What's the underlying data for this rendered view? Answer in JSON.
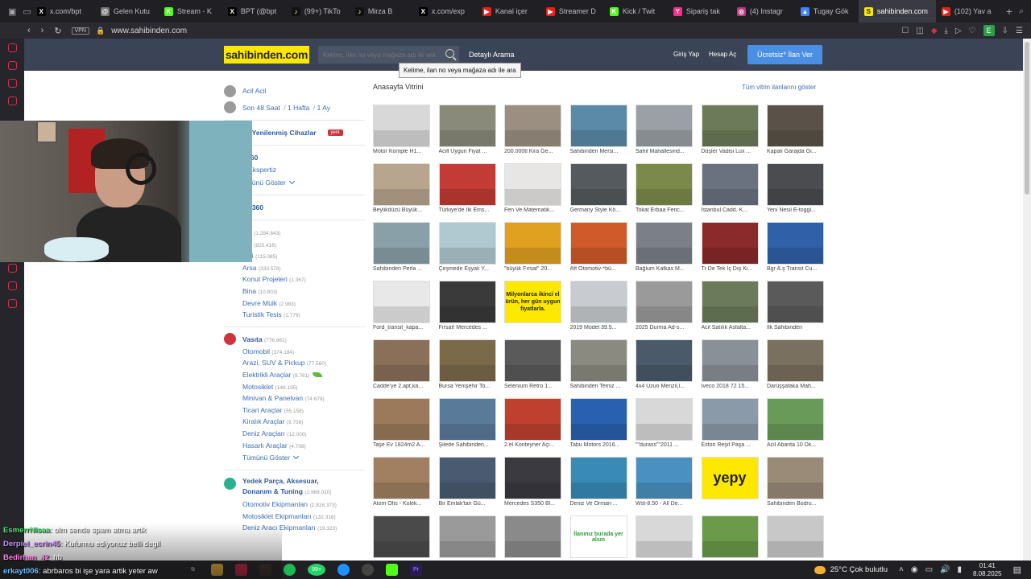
{
  "browser": {
    "tabs": [
      {
        "label": "x.com/bpt",
        "fav": "X",
        "color": "#000000"
      },
      {
        "label": "Gelen Kutu",
        "fav": "@",
        "color": "#777777"
      },
      {
        "label": "Stream - K",
        "fav": "K",
        "color": "#53fc18"
      },
      {
        "label": "BPT (@bpt",
        "fav": "X",
        "color": "#000000"
      },
      {
        "label": "(99+) TikTo",
        "fav": "♪",
        "color": "#111111"
      },
      {
        "label": "Mirza B",
        "fav": "♪",
        "color": "#111111"
      },
      {
        "label": "x.com/exp",
        "fav": "X",
        "color": "#000000"
      },
      {
        "label": "Kanal içer",
        "fav": "▶",
        "color": "#e62117"
      },
      {
        "label": "Streamer D",
        "fav": "▶",
        "color": "#e62117"
      },
      {
        "label": "Kick / Twit",
        "fav": "K",
        "color": "#53fc18"
      },
      {
        "label": "Sipariş tak",
        "fav": "Y",
        "color": "#ff2d87"
      },
      {
        "label": "(4) Instagr",
        "fav": "◎",
        "color": "#c13584"
      },
      {
        "label": "Tugay Gök",
        "fav": "▲",
        "color": "#4285f4"
      },
      {
        "label": "sahibinden.com - Ti",
        "fav": "S",
        "color": "#ffe800"
      },
      {
        "label": "(102) Yav a",
        "fav": "▶",
        "color": "#e62117"
      }
    ],
    "active_tab_index": 13,
    "vpn_label": "VPN",
    "url": "www.sahibinden.com"
  },
  "header": {
    "logo": "sahibinden.com",
    "search_placeholder": "Kelime, ilan no veya mağaza adı ile ara",
    "detailed_search": "Detaylı Arama",
    "login": "Giriş Yap",
    "register": "Hesap Aç",
    "post_ad": "Ücretsiz* İlan Ver",
    "tooltip": "Kelime, ilan no veya mağaza adı ile ara"
  },
  "left": {
    "acil": "Acil Acil",
    "recent": [
      "Son 48 Saat",
      "1 Hafta",
      "1 Ay"
    ],
    "renewed": "ile Yenilenmiş Cihazlar",
    "new_badge": "yeni",
    "oto360": "o360",
    "oto_expert": "o Ekspertiz",
    "show_all": "Tümünü Göster",
    "show_all_partial": "ümünü Göster",
    "emlak360": "lak360",
    "emlak": {
      "name": "lak",
      "count": "(1.284.643)"
    },
    "emlak_sub": [
      {
        "name": "nut",
        "count": "(820.416)"
      },
      {
        "name": "yeri",
        "count": "(115.085)"
      },
      {
        "name": "Arsa",
        "count": "(333.578)"
      },
      {
        "name": "Konut Projeleri",
        "count": "(1.367)"
      },
      {
        "name": "Bina",
        "count": "(10.803)"
      },
      {
        "name": "Devre Mülk",
        "count": "(2.983)"
      },
      {
        "name": "Turistik Tesis",
        "count": "(1.779)"
      }
    ],
    "vasita": {
      "name": "Vasıta",
      "count": "(776.961)"
    },
    "vasita_sub": [
      {
        "name": "Otomobil",
        "count": "(374.184)"
      },
      {
        "name": "Arazi, SUV & Pickup",
        "count": "(77.560)"
      },
      {
        "name": "Elektrikli Araçlar",
        "count": "(8.761)"
      },
      {
        "name": "Motosiklet",
        "count": "(148.195)"
      },
      {
        "name": "Minivan & Panelvan",
        "count": "(74.678)"
      },
      {
        "name": "Ticari Araçlar",
        "count": "(55.158)"
      },
      {
        "name": "Kiralık Araçlar",
        "count": "(9.756)"
      },
      {
        "name": "Deniz Araçları",
        "count": "(12.000)"
      },
      {
        "name": "Hasarlı Araçlar",
        "count": "(4.708)"
      }
    ],
    "yedek": {
      "name1": "Yedek Parça, Aksesuar,",
      "name2": "Donanım & Tuning",
      "count": "(2.968.010)"
    },
    "yedek_sub": [
      {
        "name": "Otomotiv Ekipmanları",
        "count": "(2.816.373)"
      },
      {
        "name": "Motosiklet Ekipmanları",
        "count": "(132.316)"
      },
      {
        "name": "Deniz Aracı Ekipmanları",
        "count": "(19.323)"
      }
    ]
  },
  "showcase": {
    "title": "Anasayfa Vitrini",
    "show_all": "Tüm vitrin ilanlarını göster",
    "ad_text": "Milyonlarca ikinci el ürün, her gün uygun fiyatlarla.",
    "ad_yepy": "yepy",
    "ad_here": "İlanınız burada yer alsın",
    "items": [
      {
        "caption": "Motor Komple H1...",
        "color": "#d8d8d8"
      },
      {
        "caption": "Acill Uygun Fiyat ...",
        "color": "#8a8a7a"
      },
      {
        "caption": "200.000tl Kira Ge...",
        "color": "#9a8f80"
      },
      {
        "caption": "Sahibinden Mersi...",
        "color": "#5a8aa8"
      },
      {
        "caption": "Sahil Mahallesind...",
        "color": "#9aa0a6"
      },
      {
        "caption": "Düşler Vadisi Lux ...",
        "color": "#6d7a5a"
      },
      {
        "caption": "Kapalı Garajda Gi...",
        "color": "#5a5248"
      },
      {
        "caption": "Beylikdüzü Büyük...",
        "color": "#b8a58e"
      },
      {
        "caption": "Türkiye'de İlk Ems...",
        "color": "#c23b35"
      },
      {
        "caption": "Fen Ve Matematik...",
        "color": "#e8e6e4"
      },
      {
        "caption": "Germany Style Kö...",
        "color": "#555a5e"
      },
      {
        "caption": "Tokat Erbaa Feric...",
        "color": "#7b8a4a"
      },
      {
        "caption": "İstanbul Cadd. K...",
        "color": "#6a7280"
      },
      {
        "caption": "Yeni Nesil E-toggl...",
        "color": "#4a4c50"
      },
      {
        "caption": "Sahibinden Perla ...",
        "color": "#8aa0a8"
      },
      {
        "caption": "Çeşmede Eşyalı Y...",
        "color": "#b0c8d0"
      },
      {
        "caption": "\"büyük Fırsat\" 20...",
        "color": "#e0a020"
      },
      {
        "caption": "Aft Otomotiv-*bü...",
        "color": "#d05a2a"
      },
      {
        "caption": "Bağlum Kafkas M...",
        "color": "#7a7f88"
      },
      {
        "caption": "Tr De Tek İç Dış Ki...",
        "color": "#8a2a2a"
      },
      {
        "caption": "Bgr A.ş Transit Cu...",
        "color": "#3060a8"
      },
      {
        "caption": "Ford_transit_kapa...",
        "color": "#e8e8e8"
      },
      {
        "caption": "Fırsat! Mercedes ...",
        "color": "#3a3a3a"
      },
      {
        "caption": "",
        "color": "#ffe800",
        "ad": "ad1"
      },
      {
        "caption": "2019 Model 39.5...",
        "color": "#c8ccd0"
      },
      {
        "caption": "2025 Durma Ad-s...",
        "color": "#9a9a9a"
      },
      {
        "caption": "Acil Satılık Asfalta...",
        "color": "#6a7a5a"
      },
      {
        "caption": "İlk Sahibinden",
        "color": "#5a5a5a"
      },
      {
        "caption": "Cadde'ye 2.apt,ka...",
        "color": "#8a7058"
      },
      {
        "caption": "Bursa Yenişehir To...",
        "color": "#7a6a4a"
      },
      {
        "caption": "Selenium Retro 1...",
        "color": "#5a5a5a"
      },
      {
        "caption": "Sahibinden Temiz ...",
        "color": "#8a8a80"
      },
      {
        "caption": "4x4 Uzun Menzil,l...",
        "color": "#4a5a6a"
      },
      {
        "caption": "İveco 2018 72 15...",
        "color": "#8a9098"
      },
      {
        "caption": "Darüşşafaka Mah...",
        "color": "#7a7060"
      },
      {
        "caption": "Taşe Ev 1824m2 A...",
        "color": "#9a7a5a"
      },
      {
        "caption": "Şilede Sahibinden...",
        "color": "#5a7a9a"
      },
      {
        "caption": "2.el Konteyner Açı...",
        "color": "#c04030"
      },
      {
        "caption": "Tabu Motors 2016...",
        "color": "#2a60b0"
      },
      {
        "caption": "\"\"durass\"\"2011 ...",
        "color": "#d8d8d8"
      },
      {
        "caption": "Eston Reşit Paşa ...",
        "color": "#8a9aa8"
      },
      {
        "caption": "Acil Abanta 10 Dk...",
        "color": "#6a9a5a"
      },
      {
        "caption": "Atom Ofis - Kolek...",
        "color": "#a08060"
      },
      {
        "caption": "Bir Emlak'tan Gü...",
        "color": "#4a5a70"
      },
      {
        "caption": "Mercedes S350 Bl...",
        "color": "#3a3a40"
      },
      {
        "caption": "Deniz Ve Orman ...",
        "color": "#3a8ab8"
      },
      {
        "caption": "Wst-8.50 - All De...",
        "color": "#4a90c0"
      },
      {
        "caption": "",
        "color": "#ffe800",
        "ad": "ad2"
      },
      {
        "caption": "Sahibinden Bodru...",
        "color": "#9a8a78"
      },
      {
        "caption": "",
        "color": "#4a4a4a"
      },
      {
        "caption": "",
        "color": "#9a9a9a"
      },
      {
        "caption": "",
        "color": "#8a8a8a"
      },
      {
        "caption": "",
        "color": "#ffffff",
        "ad": "ad3"
      },
      {
        "caption": "",
        "color": "#d8d8d8"
      },
      {
        "caption": "",
        "color": "#6a9a4a"
      },
      {
        "caption": "",
        "color": "#c8c8c8"
      }
    ]
  },
  "chat": [
    {
      "user": "EsmerrNisaa",
      "text": ": olm sende spam atma artik",
      "color": "#55e07a"
    },
    {
      "user": "Derpiel_ecrin45",
      "text": ": Kufurmu ediyonuz belli degil",
      "color": "#c98cff"
    },
    {
      "user": "Bedirhan_42",
      "text": ": hb",
      "color": "#ff7de0"
    },
    {
      "user": "erkayt006",
      "text": ": abrbaros bi işe yara artik yeter aw",
      "color": "#6cc0ff"
    }
  ],
  "taskbar": {
    "weather": "25°C  Çok bulutlu",
    "time": "01:41",
    "date": "8.08.2025",
    "badge": "99+"
  }
}
